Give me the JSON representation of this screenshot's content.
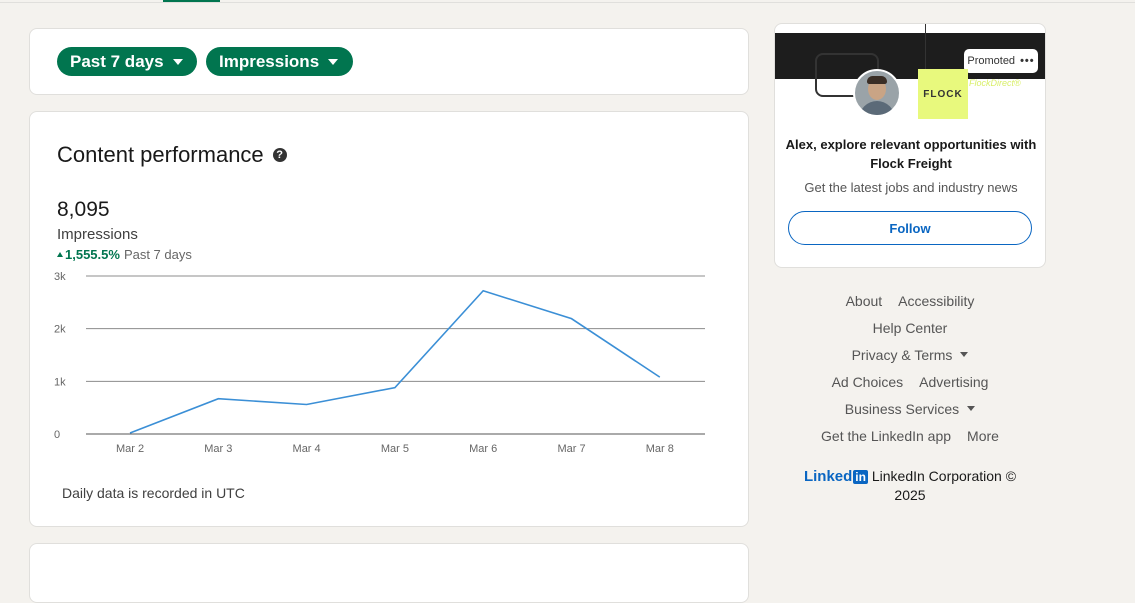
{
  "filters": {
    "date_range": "Past 7 days",
    "metric": "Impressions"
  },
  "performance": {
    "title": "Content performance",
    "total": "8,095",
    "metric_label": "Impressions",
    "change": "1,555.5%",
    "change_period": "Past 7 days",
    "footnote": "Daily data is recorded in UTC"
  },
  "chart_data": {
    "type": "line",
    "categories": [
      "Mar 2",
      "Mar 3",
      "Mar 4",
      "Mar 5",
      "Mar 6",
      "Mar 7",
      "Mar 8"
    ],
    "values": [
      20,
      670,
      560,
      880,
      2720,
      2190,
      1080
    ],
    "yticks": [
      0,
      1000,
      2000,
      3000
    ],
    "ytick_labels": [
      "0",
      "1k",
      "2k",
      "3k"
    ],
    "ylim": [
      0,
      3000
    ],
    "grid": true,
    "line_color": "#3b8fd6"
  },
  "ad": {
    "promoted_label": "Promoted",
    "brand_tagline": "FlockDirect®",
    "logo_text": "FLOCK",
    "headline_line1": "Alex, explore relevant opportunities with",
    "headline_line2": "Flock Freight",
    "subtext": "Get the latest jobs and industry news",
    "follow_label": "Follow"
  },
  "footer": {
    "about": "About",
    "accessibility": "Accessibility",
    "help_center": "Help Center",
    "privacy_terms": "Privacy & Terms",
    "ad_choices": "Ad Choices",
    "advertising": "Advertising",
    "business_services": "Business Services",
    "get_app": "Get the LinkedIn app",
    "more": "More",
    "logo_text": "Linked",
    "logo_box": "in",
    "corporation": "LinkedIn Corporation ©",
    "year": "2025"
  },
  "colors": {
    "accent_green": "#01754f",
    "linkedin_blue": "#0a66c2"
  }
}
